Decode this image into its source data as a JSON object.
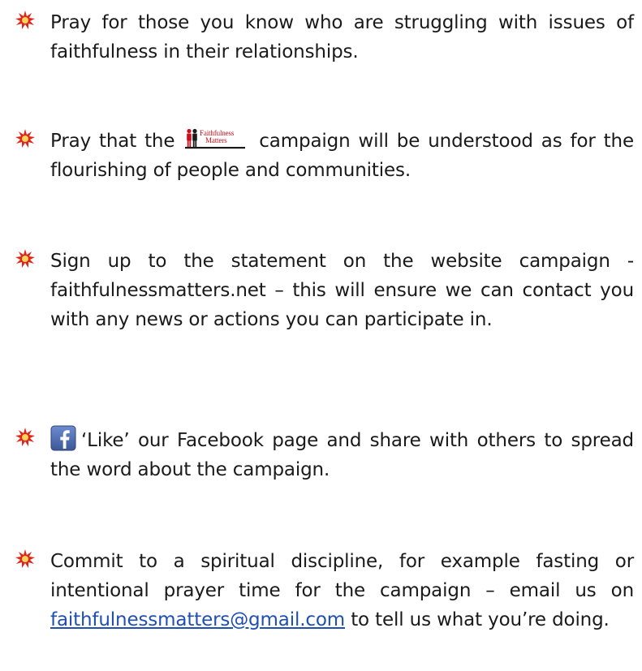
{
  "colors": {
    "bullet_outer": "#e0261b",
    "bullet_inner": "#ffd25a",
    "link": "#1f4fb5",
    "logo_red": "#c8101e",
    "facebook_blue": "#3b5998"
  },
  "icons": {
    "bullet": "red-starburst-bullet",
    "inline_logo": "faithfulness-matters-logo",
    "facebook": "facebook-logo"
  },
  "logo": {
    "line1": "Faithfulness",
    "line2": "Matters"
  },
  "items": [
    {
      "text": "Pray for those you know who are struggling with issues of faithfulness in their relationships."
    },
    {
      "text_before": "Pray that the ",
      "text_after": " campaign will be understood as for the flourishing of people and communities."
    },
    {
      "text": "Sign up to the statement on the website campaign - faithfulnessmatters.net – this will ensure we can contact you with any news or actions you can participate in."
    },
    {
      "text": "‘Like’ our Facebook page and share with others to spread the word about the campaign."
    },
    {
      "text_before": "Commit to a spiritual discipline, for example fasting or intentional prayer time for the campaign – email us on ",
      "link": "faithfulnessmatters@gmail.com",
      "text_after": " to tell us what you’re doing."
    }
  ]
}
